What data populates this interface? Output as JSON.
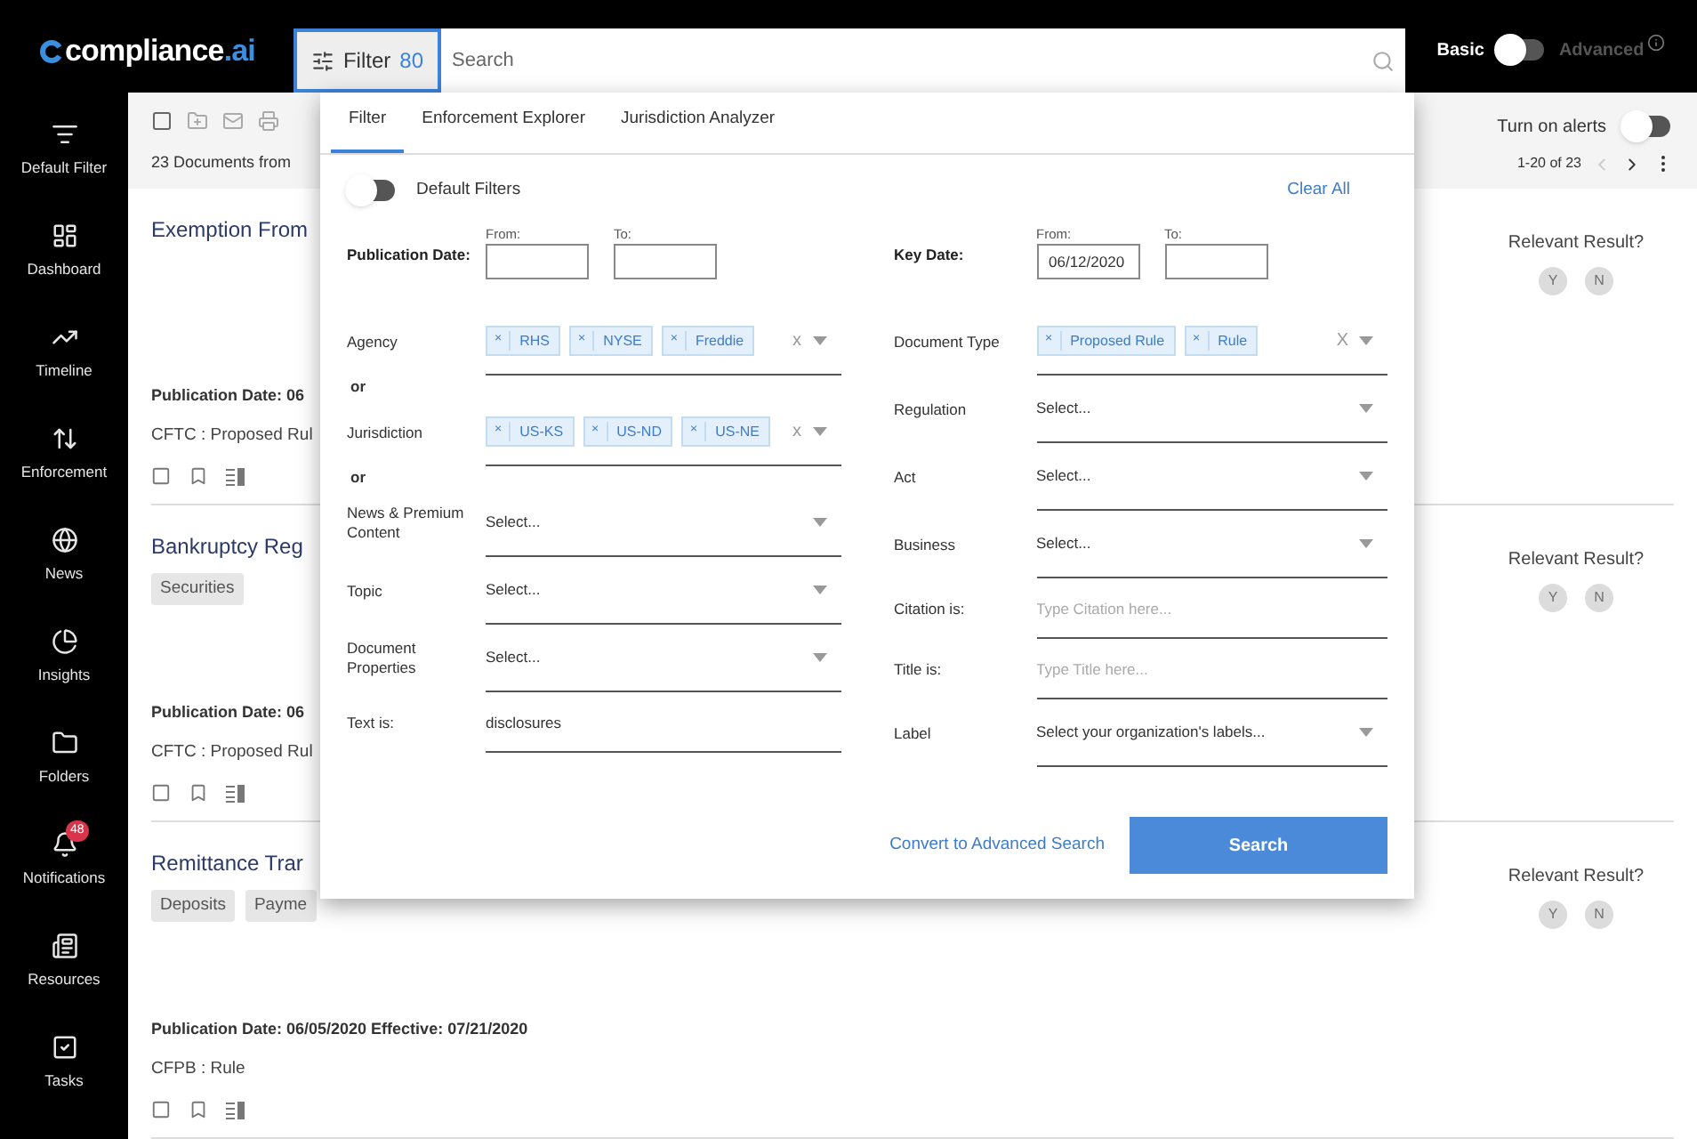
{
  "logo": {
    "name": "compliance",
    "accent": ".ai"
  },
  "filter_button": {
    "label": "Filter",
    "count": "80",
    "selected": true
  },
  "search": {
    "placeholder": "Search"
  },
  "mode_switch": {
    "left_label": "Basic",
    "right_label": "Advanced",
    "advanced": false
  },
  "sidebar": {
    "items": [
      {
        "label": "Default Filter"
      },
      {
        "label": "Dashboard"
      },
      {
        "label": "Timeline"
      },
      {
        "label": "Enforcement"
      },
      {
        "label": "News"
      },
      {
        "label": "Insights"
      },
      {
        "label": "Folders"
      },
      {
        "label": "Notifications",
        "badge": "48"
      },
      {
        "label": "Resources"
      },
      {
        "label": "Tasks"
      }
    ]
  },
  "toolbar": {
    "summary": "23 Documents from",
    "alerts_label": "Turn on alerts",
    "alerts_on": false,
    "pagination": "1-20 of 23"
  },
  "documents": [
    {
      "title": "Exemption From",
      "date": "Publication Date: 06",
      "source": "CFTC : Proposed Rul",
      "relevance_label": "Relevant Result?",
      "options": [
        "Y",
        "N"
      ]
    },
    {
      "title": "Bankruptcy Reg",
      "tags": [
        "Securities"
      ],
      "date": "Publication Date: 06",
      "source": "CFTC : Proposed Rul",
      "relevance_label": "Relevant Result?",
      "options": [
        "Y",
        "N"
      ]
    },
    {
      "title": "Remittance Trar",
      "tags": [
        "Deposits",
        "Payme"
      ],
      "date": "Publication Date: 06/05/2020 Effective: 07/21/2020",
      "source": "CFPB : Rule",
      "relevance_label": "Relevant Result?",
      "options": [
        "Y",
        "N"
      ]
    }
  ],
  "filter_panel": {
    "tabs": [
      {
        "label": "Filter",
        "selected": true
      },
      {
        "label": "Enforcement Explorer",
        "selected": false
      },
      {
        "label": "Jurisdiction Analyzer",
        "selected": false
      }
    ],
    "default_filters": {
      "label": "Default Filters",
      "on": false
    },
    "clear_all": "Clear All",
    "left_fields": [
      {
        "kind": "date",
        "label": "Publication Date:",
        "from_label": "From:",
        "to_label": "To:"
      },
      {
        "kind": "multi",
        "label": "Agency",
        "chips": [
          "RHS",
          "NYSE",
          "Freddie"
        ],
        "chip_remove": "×",
        "clear": "x"
      },
      {
        "kind": "connector",
        "label": "or"
      },
      {
        "kind": "multi",
        "label": "Jurisdiction",
        "chips": [
          "US-KS",
          "US-ND",
          "US-NE"
        ],
        "chip_remove": "×",
        "clear": "x"
      },
      {
        "kind": "connector",
        "label": "or"
      },
      {
        "kind": "select",
        "label": "News & Premium Content",
        "placeholder": "Select..."
      },
      {
        "kind": "select",
        "label": "Topic",
        "placeholder": "Select..."
      },
      {
        "kind": "select",
        "label": "Document Properties",
        "placeholder": "Select..."
      },
      {
        "kind": "text",
        "label": "Text is:",
        "value": "disclosures"
      }
    ],
    "right_fields": [
      {
        "kind": "date",
        "label": "Key Date:",
        "from_label": "From:",
        "to_label": "To:",
        "from": "06/12/2020"
      },
      {
        "kind": "multi",
        "label": "Document Type",
        "chips": [
          "Proposed Rule",
          "Rule"
        ],
        "chip_remove": "×",
        "clear": "X"
      },
      {
        "kind": "select",
        "label": "Regulation",
        "placeholder": "Select..."
      },
      {
        "kind": "select",
        "label": "Act",
        "placeholder": "Select..."
      },
      {
        "kind": "select",
        "label": "Business",
        "placeholder": "Select..."
      },
      {
        "kind": "text",
        "label": "Citation is:",
        "placeholder": "Type Citation here..."
      },
      {
        "kind": "text",
        "label": "Title is:",
        "placeholder": "Type Title here..."
      },
      {
        "kind": "select",
        "label": "Label",
        "placeholder": "Select your organization's labels..."
      }
    ],
    "convert_link": "Convert to Advanced Search",
    "search_button": "Search"
  }
}
